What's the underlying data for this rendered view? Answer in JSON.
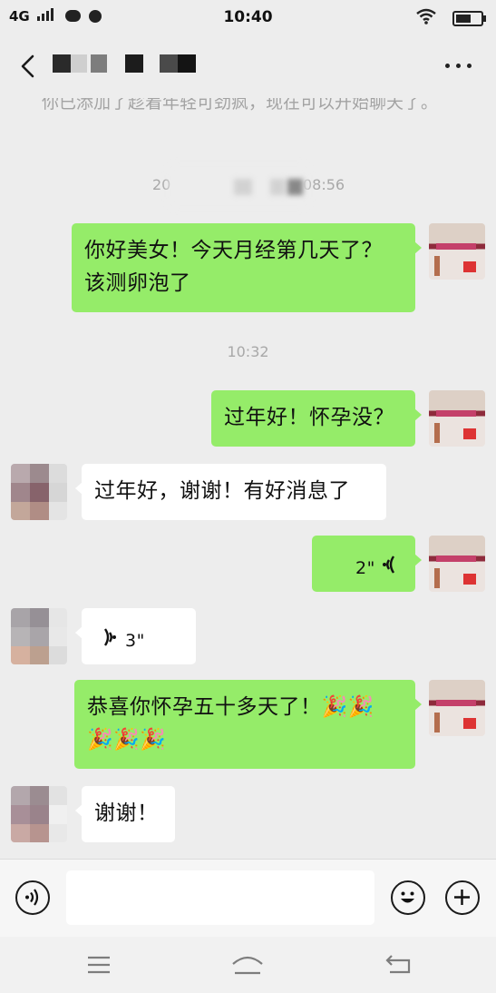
{
  "status_bar": {
    "network": "4G",
    "time": "10:40",
    "icons": [
      "signal-bars-icon",
      "cloud-icon",
      "moon-icon",
      "wifi-icon",
      "battery-icon"
    ]
  },
  "header": {
    "back_icon": "chevron-left-icon",
    "more_icon": "more-dots-icon",
    "title_note": ""
  },
  "chat": {
    "system_message": "你已添加了趁着年轻可劲疯，现在可以开始聊天了。",
    "timestamps": [
      "20",
      "08:56",
      "10:32"
    ],
    "messages": [
      {
        "side": "me",
        "type": "text",
        "text": "你好美女！今天月经第几天了？该测卵泡了"
      },
      {
        "side": "me",
        "type": "text",
        "text": "过年好！怀孕没？"
      },
      {
        "side": "other",
        "type": "text",
        "text": "过年好，谢谢！有好消息了"
      },
      {
        "side": "me",
        "type": "voice",
        "duration": "2\""
      },
      {
        "side": "other",
        "type": "voice",
        "duration": "3\""
      },
      {
        "side": "me",
        "type": "text",
        "text": "恭喜你怀孕五十多天了！",
        "emoji": [
          "🎉",
          "🎉",
          "🎉",
          "🎉",
          "🎉"
        ]
      },
      {
        "side": "other",
        "type": "text",
        "text": "谢谢！"
      }
    ]
  },
  "input_bar": {
    "voice_icon": "voice-mode-icon",
    "emoji_icon": "emoji-icon",
    "plus_icon": "plus-icon",
    "input_value": ""
  },
  "nav_bar": {
    "icons": [
      "menu-icon",
      "home-icon",
      "back-icon"
    ]
  },
  "colors": {
    "background": "#ededed",
    "my_bubble": "#95ec69",
    "their_bubble": "#ffffff",
    "timestamp": "#a8a8a8"
  }
}
